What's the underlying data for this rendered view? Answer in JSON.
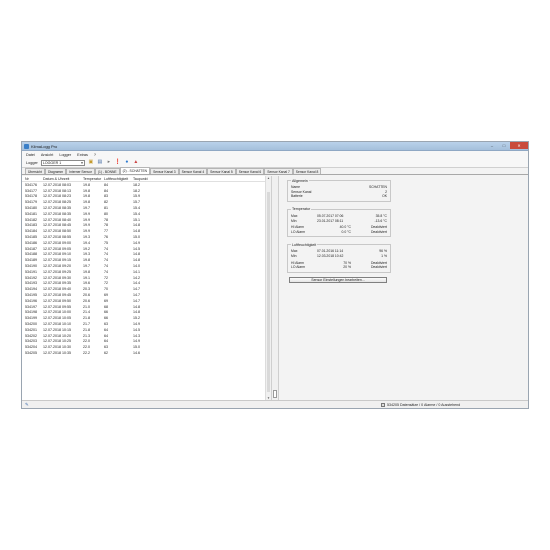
{
  "window": {
    "title": "KlimaLogg Pro"
  },
  "menu": [
    "Datei",
    "Ansicht",
    "Logger",
    "Extras",
    "?"
  ],
  "toolbar": {
    "logger_label": "Logger",
    "logger_value": "LOGGER 1"
  },
  "tabs": [
    {
      "label": "Übersicht",
      "active": false
    },
    {
      "label": "Diagramm",
      "active": false
    },
    {
      "label": "Interner Sensor",
      "active": false
    },
    {
      "label": "(1) - BONNE",
      "active": false
    },
    {
      "label": "(2) - SCHATTEN",
      "active": true
    },
    {
      "label": "Sensor Kanal 3",
      "active": false
    },
    {
      "label": "Sensor Kanal 4",
      "active": false
    },
    {
      "label": "Sensor Kanal 5",
      "active": false
    },
    {
      "label": "Sensor Kanal 6",
      "active": false
    },
    {
      "label": "Sensor Kanal 7",
      "active": false
    },
    {
      "label": "Sensor Kanal 8",
      "active": false
    }
  ],
  "table": {
    "headers": [
      "Nr",
      "Datum & Uhrzeit",
      "Temperatur",
      "Luftfeuchtigkeit",
      "Taupunkt"
    ],
    "rows": [
      [
        "534176",
        "12.07.2018 08:03",
        "19.8",
        "84",
        "18.2"
      ],
      [
        "534177",
        "12.07.2018 08:13",
        "19.8",
        "84",
        "18.2"
      ],
      [
        "534178",
        "12.07.2018 08:23",
        "19.8",
        "83",
        "15.9"
      ],
      [
        "534179",
        "12.07.2018 08:25",
        "19.8",
        "82",
        "15.7"
      ],
      [
        "534180",
        "12.07.2018 08:35",
        "19.7",
        "81",
        "15.4"
      ],
      [
        "534181",
        "12.07.2018 08:35",
        "19.9",
        "80",
        "15.4"
      ],
      [
        "534182",
        "12.07.2018 08:40",
        "19.9",
        "78",
        "15.1"
      ],
      [
        "534183",
        "12.07.2018 08:45",
        "19.9",
        "78",
        "14.8"
      ],
      [
        "534184",
        "12.07.2018 08:50",
        "19.9",
        "77",
        "14.8"
      ],
      [
        "534185",
        "12.07.2018 08:55",
        "19.3",
        "76",
        "15.0"
      ],
      [
        "534186",
        "12.07.2018 09:00",
        "19.4",
        "75",
        "14.9"
      ],
      [
        "534187",
        "12.07.2018 09:05",
        "19.2",
        "74",
        "14.5"
      ],
      [
        "534188",
        "12.07.2018 09:10",
        "19.3",
        "74",
        "14.8"
      ],
      [
        "534189",
        "12.07.2018 09:15",
        "19.8",
        "74",
        "14.8"
      ],
      [
        "534190",
        "12.07.2018 09:20",
        "19.7",
        "74",
        "14.0"
      ],
      [
        "534191",
        "12.07.2018 09:25",
        "19.8",
        "74",
        "14.1"
      ],
      [
        "534192",
        "12.07.2018 09:30",
        "19.1",
        "72",
        "14.2"
      ],
      [
        "534193",
        "12.07.2018 09:35",
        "19.6",
        "72",
        "14.4"
      ],
      [
        "534194",
        "12.07.2018 09:40",
        "20.3",
        "70",
        "14.7"
      ],
      [
        "534195",
        "12.07.2018 09:45",
        "20.6",
        "69",
        "14.7"
      ],
      [
        "534196",
        "12.07.2018 09:50",
        "20.6",
        "69",
        "14.7"
      ],
      [
        "534197",
        "12.07.2018 09:55",
        "21.0",
        "68",
        "14.8"
      ],
      [
        "534198",
        "12.07.2018 10:00",
        "21.4",
        "66",
        "14.8"
      ],
      [
        "534199",
        "12.07.2018 10:05",
        "21.8",
        "66",
        "15.2"
      ],
      [
        "534200",
        "12.07.2018 10:10",
        "21.7",
        "63",
        "14.9"
      ],
      [
        "534201",
        "12.07.2018 10:15",
        "21.8",
        "64",
        "14.5"
      ],
      [
        "534202",
        "12.07.2018 10:20",
        "21.3",
        "64",
        "14.3"
      ],
      [
        "534203",
        "12.07.2018 10:25",
        "22.0",
        "64",
        "14.9"
      ],
      [
        "534204",
        "12.07.2018 10:30",
        "22.0",
        "63",
        "15.0"
      ],
      [
        "534205",
        "12.07.2018 10:35",
        "22.2",
        "62",
        "14.6"
      ]
    ]
  },
  "allgemein": {
    "title": "Allgemein",
    "name_label": "Name",
    "name_value": "SCHATTEN",
    "kanal_label": "Sensor Kanal",
    "kanal_value": "2",
    "batterie_label": "Batterie",
    "batterie_value": "OK"
  },
  "temperatur": {
    "title": "Temperatur",
    "max_label": "Max",
    "max_date": "05.07.2017 07:06",
    "max_value": "35.8 °C",
    "min_label": "Min",
    "min_date": "23.01.2017 08:11",
    "min_value": "-13.6 °C",
    "hi_label": "HI Alarm",
    "hi_value": "40.0 °C",
    "hi_state": "Deaktiviert",
    "lo_label": "LO Alarm",
    "lo_value": "0.0 °C",
    "lo_state": "Deaktiviert"
  },
  "luftfeuchtigkeit": {
    "title": "Luftfeuchtigkeit",
    "max_label": "Max",
    "max_date": "07.01.2016 11:14",
    "max_value": "96 %",
    "min_label": "Min",
    "min_date": "12.03.2018 10:42",
    "min_value": "1 %",
    "hi_label": "HI Alarm",
    "hi_value": "70 %",
    "hi_state": "Deaktiviert",
    "lo_label": "LO Alarm",
    "lo_value": "20 %",
    "lo_state": "Deaktiviert"
  },
  "sensor_button": "Sensor Einstellungen bearbeiten...",
  "statusbar": {
    "text": "534205 Datensätze / 0 Alarme / 0 Ausstehend"
  }
}
